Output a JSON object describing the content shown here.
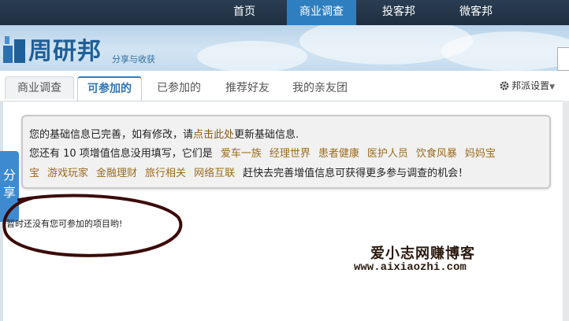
{
  "topnav": {
    "items": [
      {
        "label": "首页",
        "active": false
      },
      {
        "label": "商业调查",
        "active": true
      },
      {
        "label": "投客邦",
        "active": false
      },
      {
        "label": "微客邦",
        "active": false
      }
    ]
  },
  "header": {
    "logo_text": "周研邦",
    "slogan": "分享与收获"
  },
  "tabs": [
    {
      "label": "商业调查",
      "active": false
    },
    {
      "label": "可参加的",
      "active": true
    },
    {
      "label": "已参加的",
      "active": false
    },
    {
      "label": "推荐好友",
      "active": false
    },
    {
      "label": "我的亲友团",
      "active": false
    }
  ],
  "settings": {
    "label": "邦派设置",
    "icon": "gear-icon"
  },
  "info": {
    "line1_prefix": "您的基础信息已完善，如有修改，请",
    "line1_link": "点击此处",
    "line1_suffix": "更新基础信息.",
    "line2_prefix": "您还有 10 项增值信息没用填写，它们是",
    "tags_line2": [
      "爱车一族",
      "经理世界",
      "患者健康",
      "医护人员",
      "饮食风暴",
      "妈妈宝"
    ],
    "tags_line3_first": "宝",
    "tags_line3": [
      "游戏玩家",
      "金融理财",
      "旅行相关",
      "网络互联"
    ],
    "line3_suffix": "赶快去完善增值信息可获得更多参与调查的机会！"
  },
  "share": {
    "label1": "分",
    "label2": "享"
  },
  "empty_message": "暂时还没有您可参加的项目哟!",
  "watermark": {
    "title": "爱小志网赚博客",
    "url": "www.aixiaozhi.com"
  },
  "colors": {
    "nav_bg": "#1f2f41",
    "nav_active": "#2f7fc0",
    "tag_link": "#9c6b1c",
    "ellipse": "#3b0a08"
  }
}
